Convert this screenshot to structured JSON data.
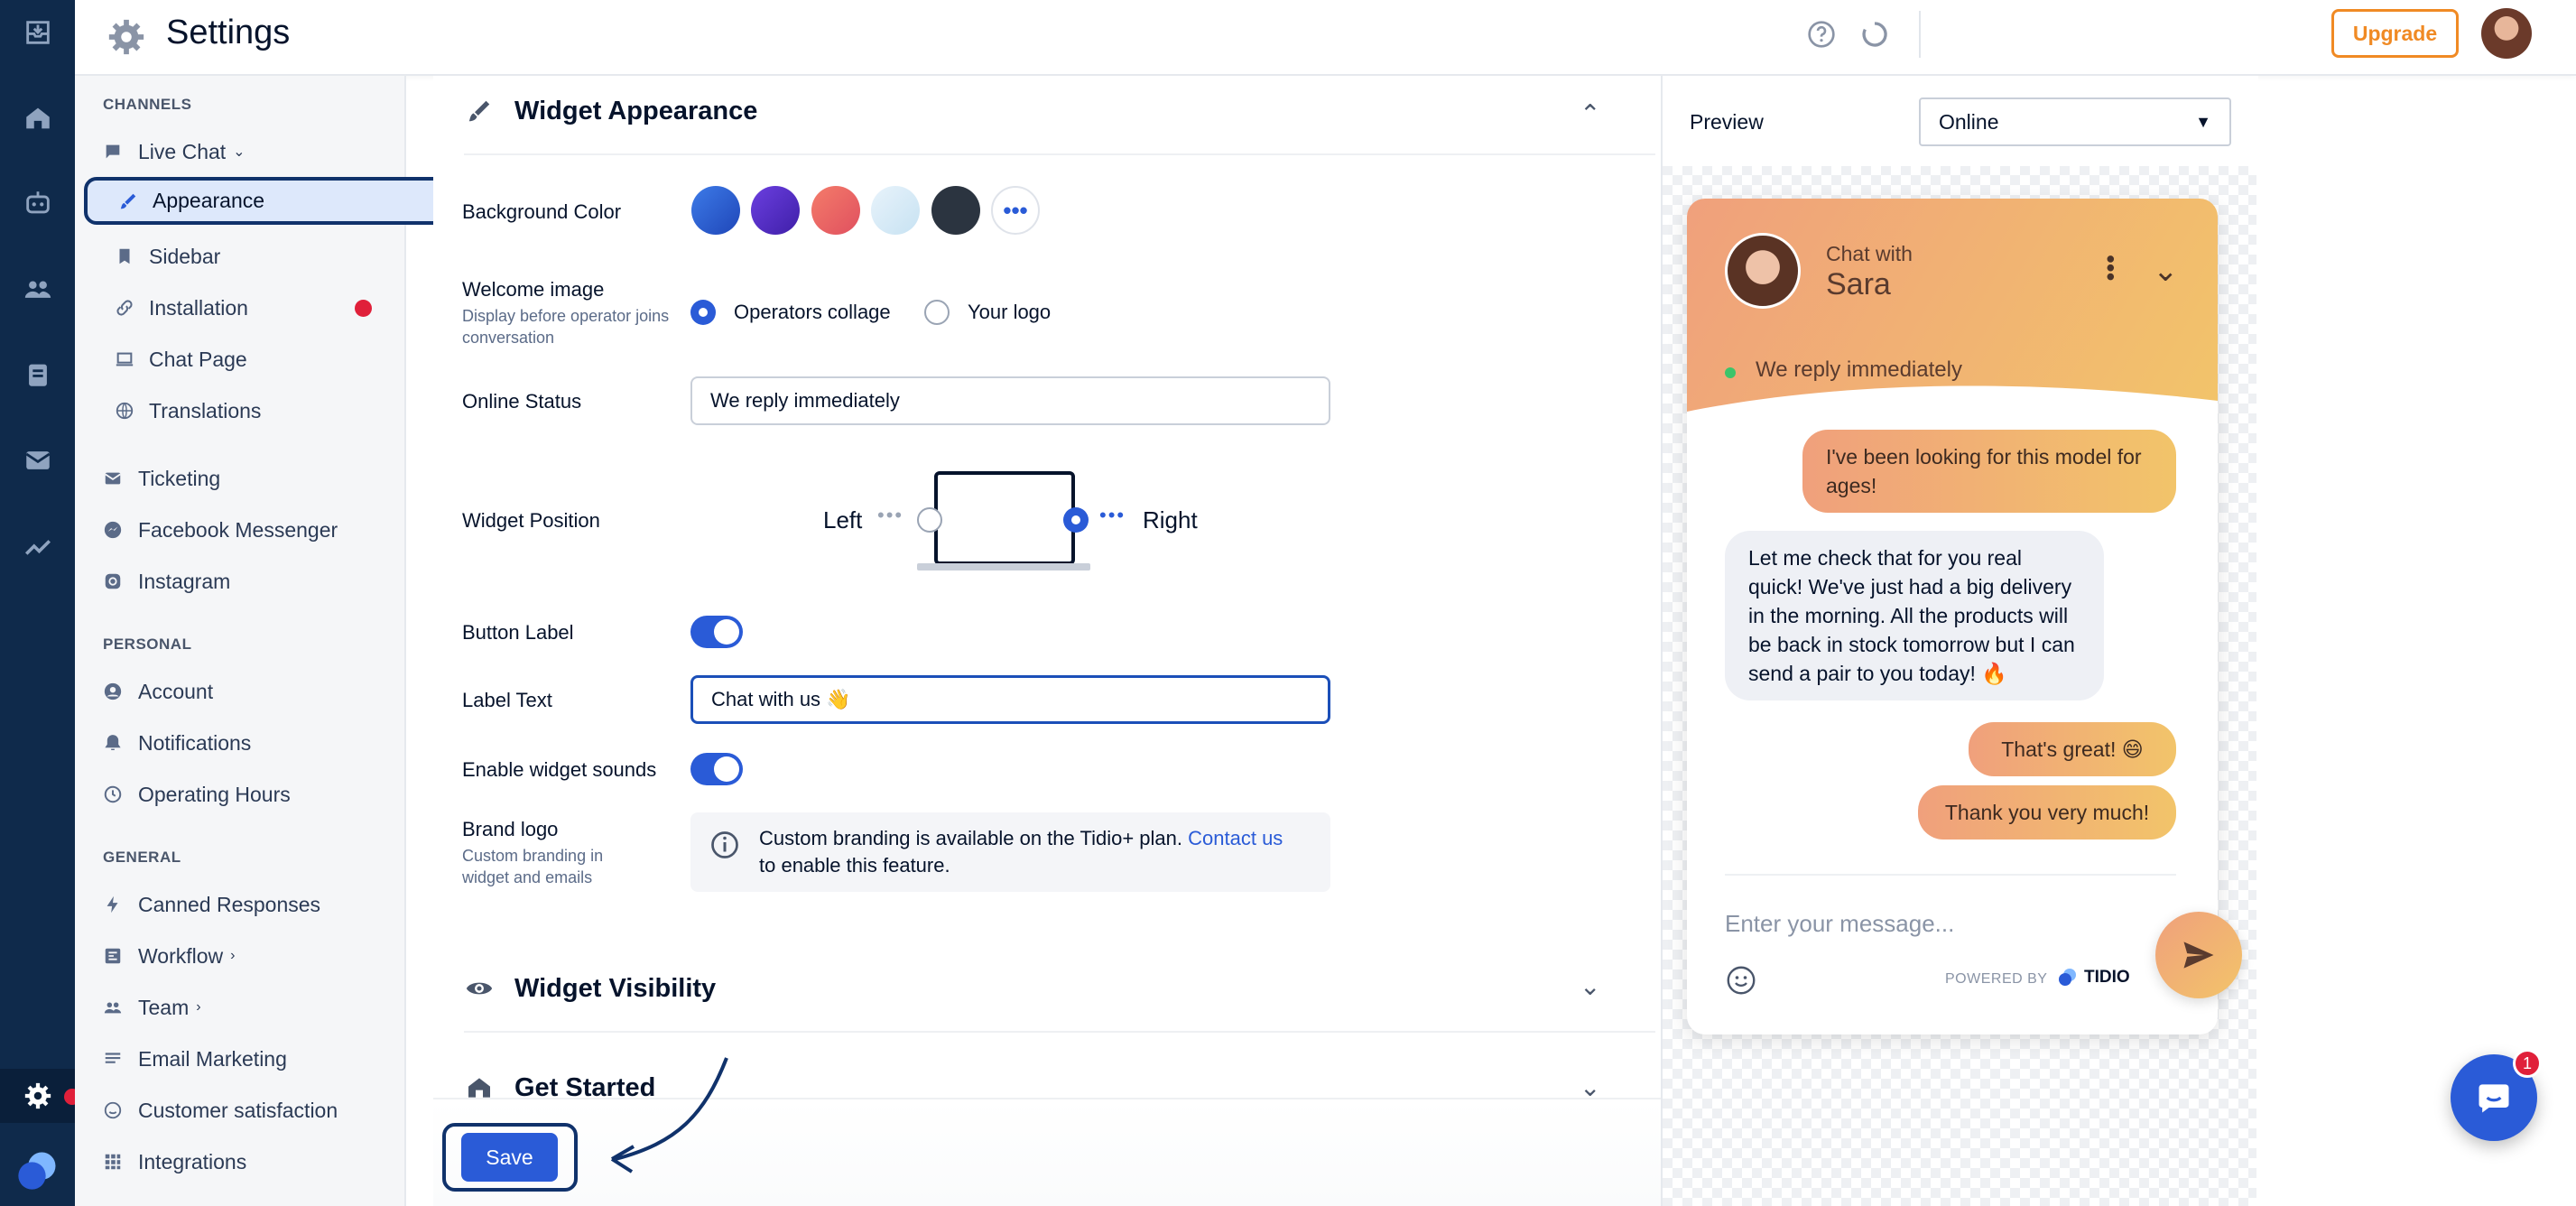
{
  "header": {
    "title": "Settings",
    "upgrade_label": "Upgrade",
    "help_icon": "help-circle-icon",
    "refresh_icon": "loading-icon"
  },
  "rail": {
    "items": [
      "inbox-icon",
      "home-icon",
      "bot-icon",
      "visitors-icon",
      "tickets-icon",
      "mail-icon",
      "analytics-icon"
    ],
    "settings_icon": "gear-icon",
    "logo": "tidio-logo-icon"
  },
  "sidebar": {
    "channels_heading": "CHANNELS",
    "live_chat": "Live Chat",
    "appearance": "Appearance",
    "sidebar_item": "Sidebar",
    "installation": "Installation",
    "chat_page": "Chat Page",
    "translations": "Translations",
    "ticketing": "Ticketing",
    "facebook": "Facebook Messenger",
    "instagram": "Instagram",
    "personal_heading": "PERSONAL",
    "account": "Account",
    "notifications": "Notifications",
    "operating_hours": "Operating Hours",
    "general_heading": "GENERAL",
    "canned": "Canned Responses",
    "workflow": "Workflow",
    "team": "Team",
    "email_marketing": "Email Marketing",
    "customer_satisfaction": "Customer satisfaction",
    "integrations": "Integrations"
  },
  "appearance": {
    "title": "Widget Appearance",
    "background_color_label": "Background Color",
    "swatches": [
      "#2a5bd7",
      "#5b2fc9",
      "#ef6b6b",
      "#d6ecf7",
      "#2b3440"
    ],
    "welcome_image_label": "Welcome image",
    "welcome_image_sub": "Display before operator joins conversation",
    "option_collage": "Operators collage",
    "option_logo": "Your logo",
    "online_status_label": "Online Status",
    "online_status_value": "We reply immediately",
    "widget_position_label": "Widget Position",
    "pos_left": "Left",
    "pos_right": "Right",
    "button_label_label": "Button Label",
    "label_text_label": "Label Text",
    "label_text_value": "Chat with us 👋",
    "sounds_label": "Enable widget sounds",
    "brand_logo_label": "Brand logo",
    "brand_logo_sub": "Custom branding in widget and emails",
    "brand_info_1": "Custom branding is available on the Tidio+ plan.",
    "brand_info_link": "Contact us",
    "brand_info_2": "to enable this feature."
  },
  "visibility": {
    "title": "Widget Visibility"
  },
  "get_started": {
    "title": "Get Started"
  },
  "save_label": "Save",
  "preview": {
    "label": "Preview",
    "select_value": "Online",
    "chat_with": "Chat with",
    "operator_name": "Sara",
    "reply_status": "We reply immediately",
    "messages": [
      {
        "from": "me",
        "text": "I've been looking for this model for ages!"
      },
      {
        "from": "op",
        "text": "Let me check that for you real quick! We've just had a big delivery in the morning. All the products will be back in stock tomorrow but I can send a pair to you today! 🔥"
      },
      {
        "from": "me",
        "text": "That's great! 😄"
      },
      {
        "from": "me",
        "text": "Thank you very much!"
      }
    ],
    "input_placeholder": "Enter your message...",
    "powered_by": "POWERED BY",
    "brand": "TIDIO"
  },
  "chat_badge": "1"
}
